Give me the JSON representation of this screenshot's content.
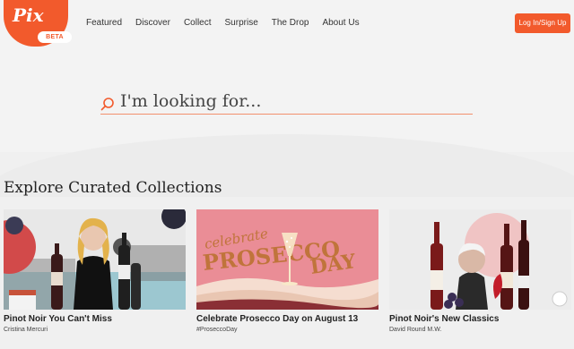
{
  "header": {
    "logo_text": "Pix",
    "logo_badge": "BETA",
    "nav": [
      "Featured",
      "Discover",
      "Collect",
      "Surprise",
      "The Drop",
      "About Us"
    ],
    "login_label": "Log In/Sign Up"
  },
  "search": {
    "placeholder": "I'm looking for..."
  },
  "section": {
    "title": "Explore Curated Collections"
  },
  "cards": [
    {
      "title": "Pinot Noir You Can't Miss",
      "subtitle": "Cristina Mercuri"
    },
    {
      "title": "Celebrate Prosecco Day on August 13",
      "subtitle": "#ProseccoDay",
      "art_line1": "celebrate",
      "art_line2": "PROSECCO",
      "art_line3": "DAY"
    },
    {
      "title": "Pinot Noir's New Classics",
      "subtitle": "David Round M.W."
    }
  ],
  "colors": {
    "brand": "#f25a2c"
  }
}
